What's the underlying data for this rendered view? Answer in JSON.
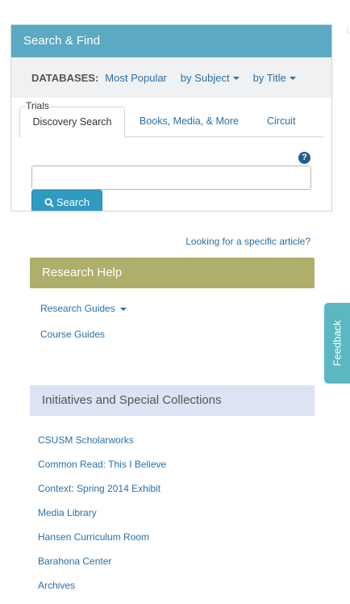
{
  "search_find": {
    "title": "Search & Find",
    "databases_label": "DATABASES:",
    "db_links": [
      "Most Popular",
      "by Subject",
      "by Title"
    ],
    "trials_label": "Trials",
    "tabs": [
      "Discovery Search",
      "Books, Media, & More",
      "Circuit"
    ],
    "help_icon": "?",
    "search_value": "",
    "search_button_label": "Search"
  },
  "article_link": "Looking for a specific article?",
  "research_help": {
    "title": "Research Help",
    "items": [
      "Research Guides",
      "Course Guides"
    ]
  },
  "initiatives": {
    "title": "Initiatives and Special Collections",
    "items": [
      "CSUSM Scholarworks",
      "Common Read: This I Believe",
      "Context: Spring 2014 Exhibit",
      "Media Library",
      "Hansen Curriculum Room",
      "Barahona Center",
      "Archives"
    ]
  },
  "feedback_label": "Feedback",
  "icons": {
    "search": "magnifier-icon",
    "help": "question-circle-icon",
    "dropdown": "caret-down-icon"
  },
  "colors": {
    "search_header": "#5ba9c2",
    "research_header": "#afae6b",
    "initiatives_header": "#dde3f3",
    "link": "#2a6fa8",
    "feedback": "#5ab7c3",
    "search_button": "#2f9bc0"
  }
}
